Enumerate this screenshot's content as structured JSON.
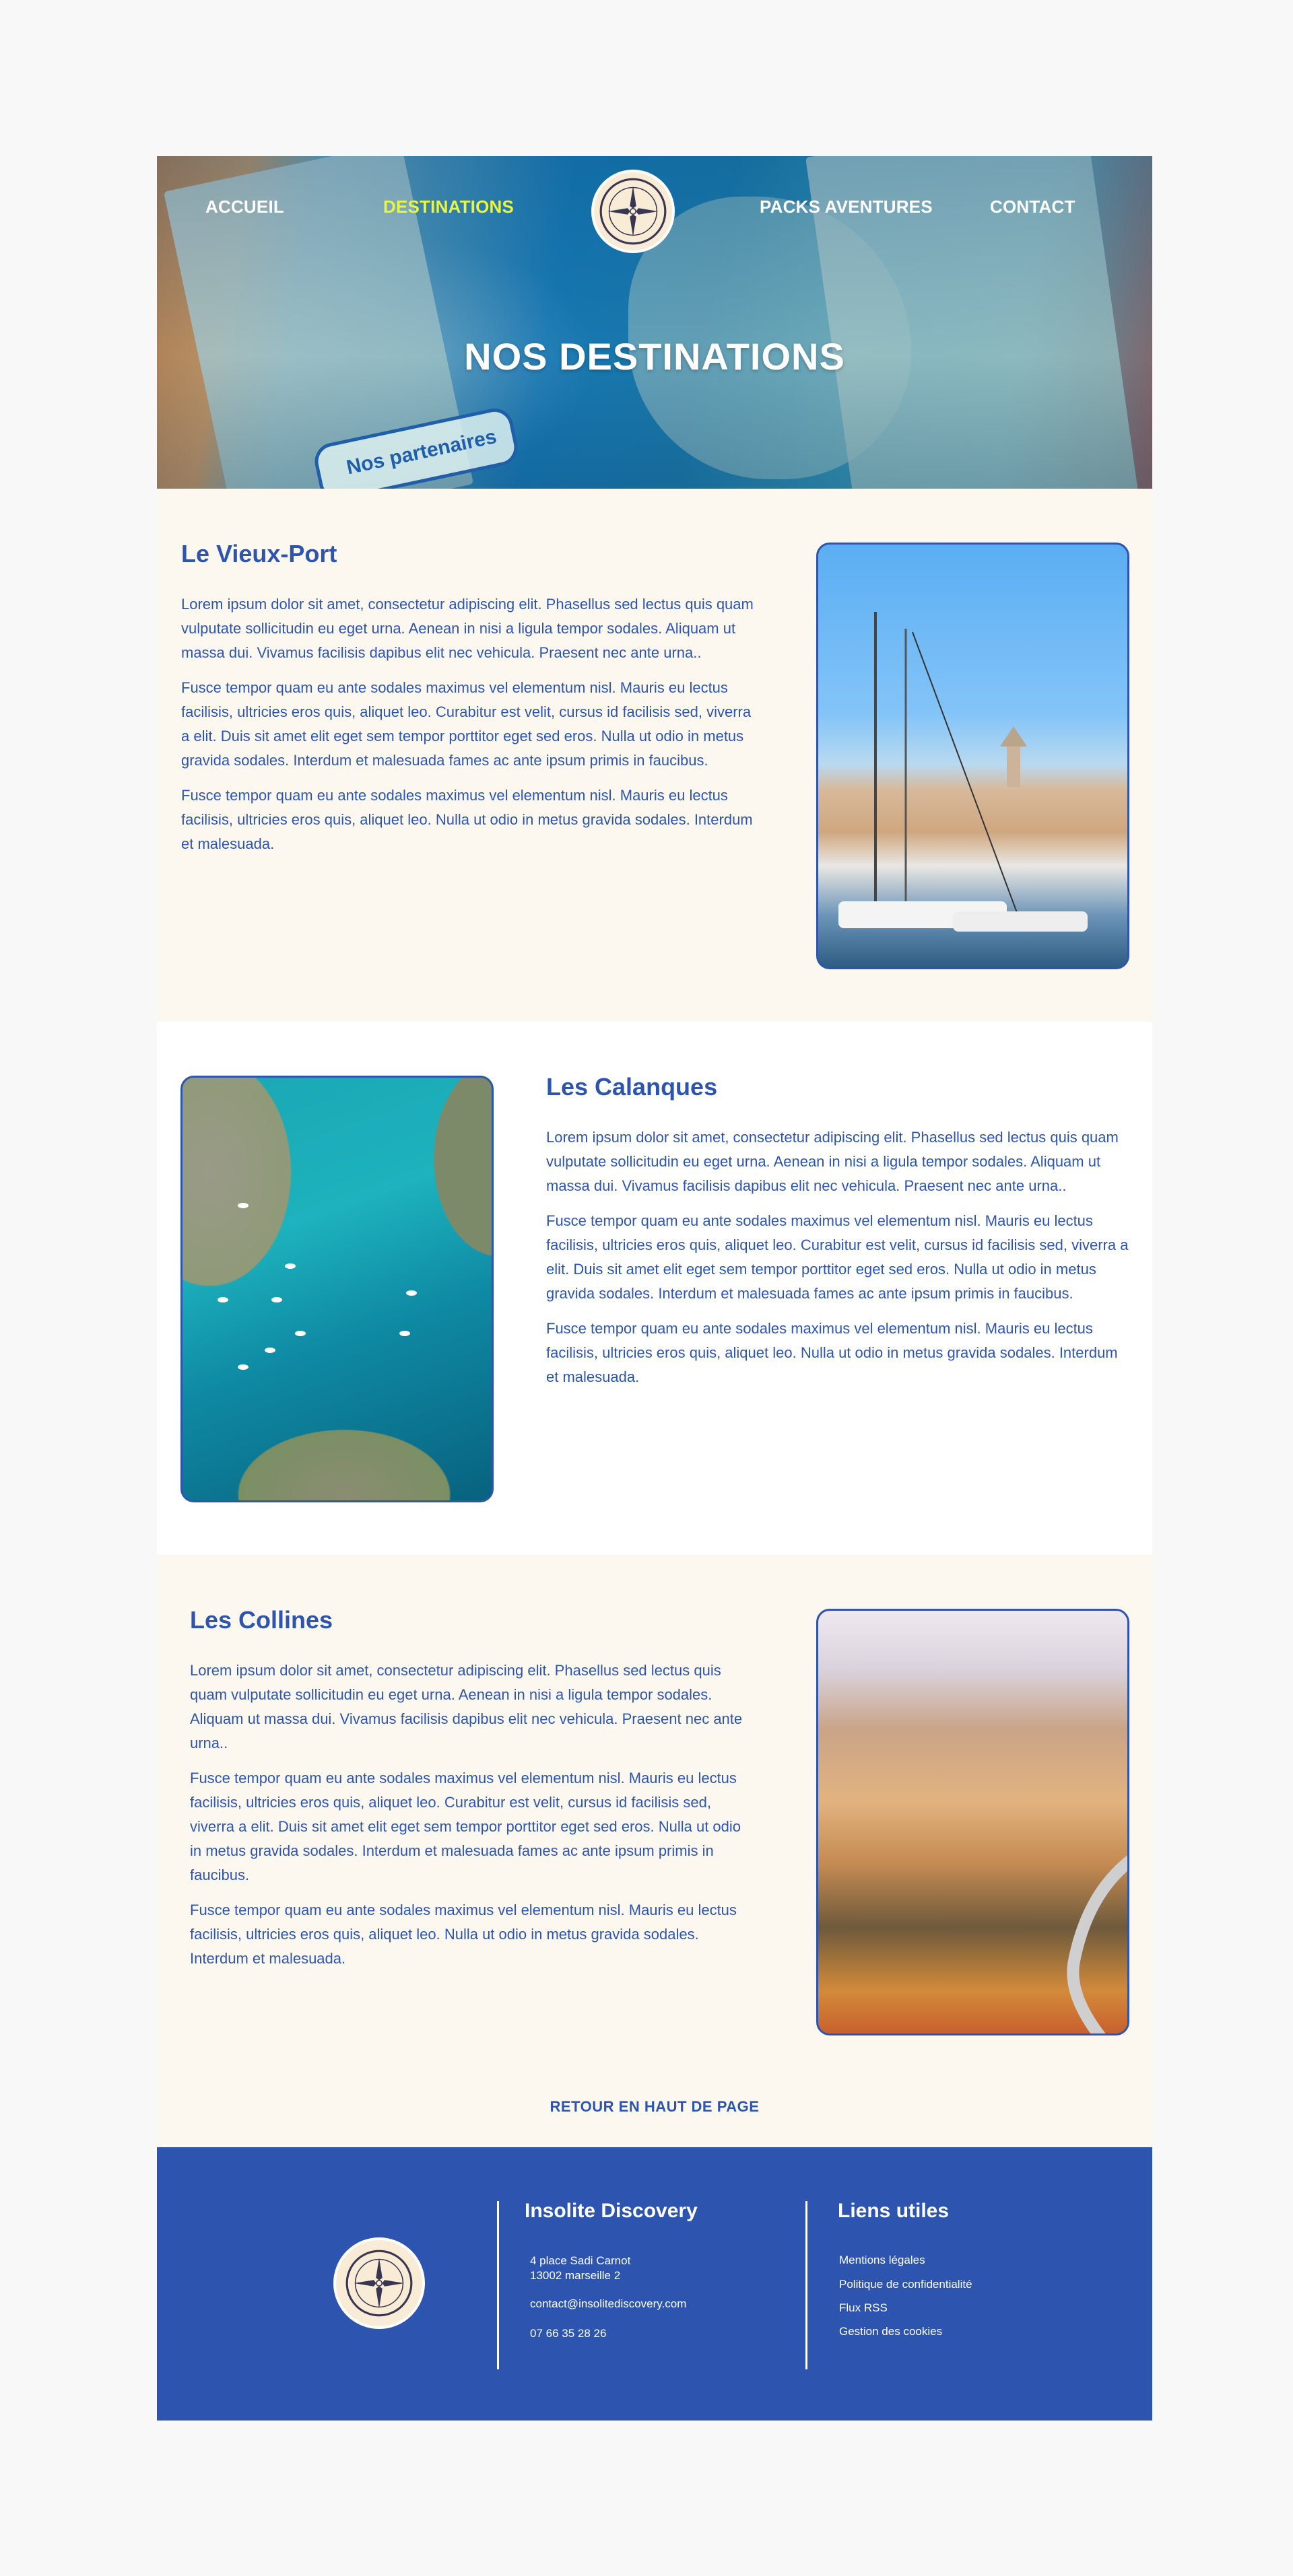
{
  "nav": {
    "items": [
      {
        "label": "ACCUEIL"
      },
      {
        "label": "DESTINATIONS"
      },
      {
        "label": "PACKS AVENTURES"
      },
      {
        "label": "CONTACT"
      }
    ],
    "active_color": "#e8f542"
  },
  "hero": {
    "title": "NOS DESTINATIONS",
    "map_badge": "Nos partenaires"
  },
  "sections": [
    {
      "title": "Le Vieux-Port",
      "paragraphs": [
        "Lorem ipsum dolor sit amet, consectetur adipiscing elit. Phasellus sed lectus quis quam vulputate sollicitudin eu eget urna. Aenean in nisi a ligula tempor sodales. Aliquam ut massa dui. Vivamus facilisis dapibus elit nec vehicula. Praesent nec ante urna..",
        "Fusce tempor quam eu ante sodales maximus vel elementum nisl. Mauris eu lectus facilisis, ultricies eros quis, aliquet leo. Curabitur est velit, cursus id facilisis sed, viverra a elit. Duis sit amet elit eget sem tempor porttitor eget sed eros. Nulla ut odio in metus gravida sodales. Interdum et malesuada fames ac ante ipsum primis in faucibus.",
        "Fusce tempor quam eu ante sodales maximus vel elementum nisl. Mauris eu lectus facilisis, ultricies eros quis, aliquet leo.  Nulla ut odio in metus gravida sodales. Interdum et malesuada."
      ]
    },
    {
      "title": "Les Calanques",
      "paragraphs": [
        "Lorem ipsum dolor sit amet, consectetur adipiscing elit. Phasellus sed lectus quis quam vulputate sollicitudin eu eget urna. Aenean in nisi a ligula tempor sodales. Aliquam ut massa dui. Vivamus facilisis dapibus elit nec vehicula. Praesent nec ante urna..",
        "Fusce tempor quam eu ante sodales maximus vel elementum nisl. Mauris eu lectus facilisis, ultricies eros quis, aliquet leo. Curabitur est velit, cursus id facilisis sed, viverra a elit. Duis sit amet elit eget sem tempor porttitor eget sed eros. Nulla ut odio in metus gravida sodales. Interdum et malesuada fames ac ante ipsum primis in faucibus.",
        "Fusce tempor quam eu ante sodales maximus vel elementum nisl. Mauris eu lectus facilisis, ultricies eros quis, aliquet leo.  Nulla ut odio in metus gravida sodales. Interdum et malesuada."
      ]
    },
    {
      "title": "Les Collines",
      "paragraphs": [
        "Lorem ipsum dolor sit amet, consectetur adipiscing elit. Phasellus sed lectus quis quam vulputate sollicitudin eu eget urna. Aenean in nisi a ligula tempor sodales. Aliquam ut massa dui. Vivamus facilisis dapibus elit nec vehicula. Praesent nec ante urna..",
        "Fusce tempor quam eu ante sodales maximus vel elementum nisl. Mauris eu lectus facilisis, ultricies eros quis, aliquet leo. Curabitur est velit, cursus id facilisis sed, viverra a elit. Duis sit amet elit eget sem tempor porttitor eget sed eros. Nulla ut odio in metus gravida sodales. Interdum et malesuada fames ac ante ipsum primis in faucibus.",
        "Fusce tempor quam eu ante sodales maximus vel elementum nisl. Mauris eu lectus facilisis, ultricies eros quis, aliquet leo.  Nulla ut odio in metus gravida sodales. Interdum et malesuada."
      ]
    }
  ],
  "back_to_top": "RETOUR EN HAUT DE PAGE",
  "footer": {
    "company": "Insolite Discovery",
    "address_line1": "4 place Sadi Carnot",
    "address_line2": "13002 marseille 2",
    "email": "contact@insolitediscovery.com",
    "phone": "07 66 35 28 26",
    "links_title": "Liens utiles",
    "links": [
      "Mentions légales",
      "Politique de confidentialité",
      "Flux RSS",
      "Gestion des cookies"
    ],
    "background": "#2d55b0"
  },
  "logo_text": "Insolite Discovery",
  "brand_color": "#2d55b0"
}
